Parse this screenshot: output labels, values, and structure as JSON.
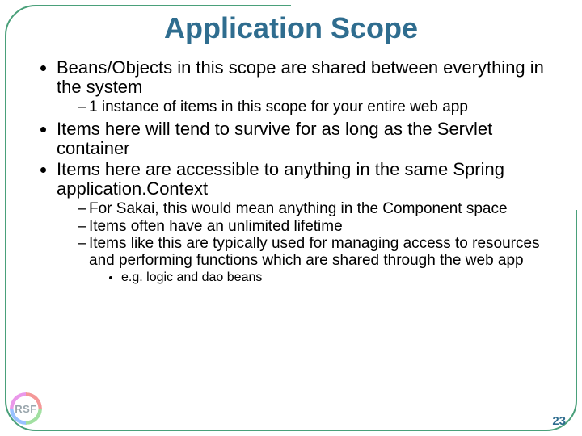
{
  "title": "Application Scope",
  "bullets": {
    "b1": "Beans/Objects in this scope are shared between everything in the system",
    "b1s1": "1 instance of items in this scope for your entire web app",
    "b2": "Items here will tend to survive for as long as the Servlet container",
    "b3": "Items here are accessible to anything in the same Spring application.Context",
    "b3s1": "For Sakai, this would mean anything in the Component space",
    "b3s2": "Items often have an unlimited lifetime",
    "b3s3": "Items like this are typically used for managing access to resources and performing functions which are shared through the web app",
    "b3s3a": "e.g. logic and dao beans"
  },
  "logo_text": "RSF",
  "page_number": "23"
}
